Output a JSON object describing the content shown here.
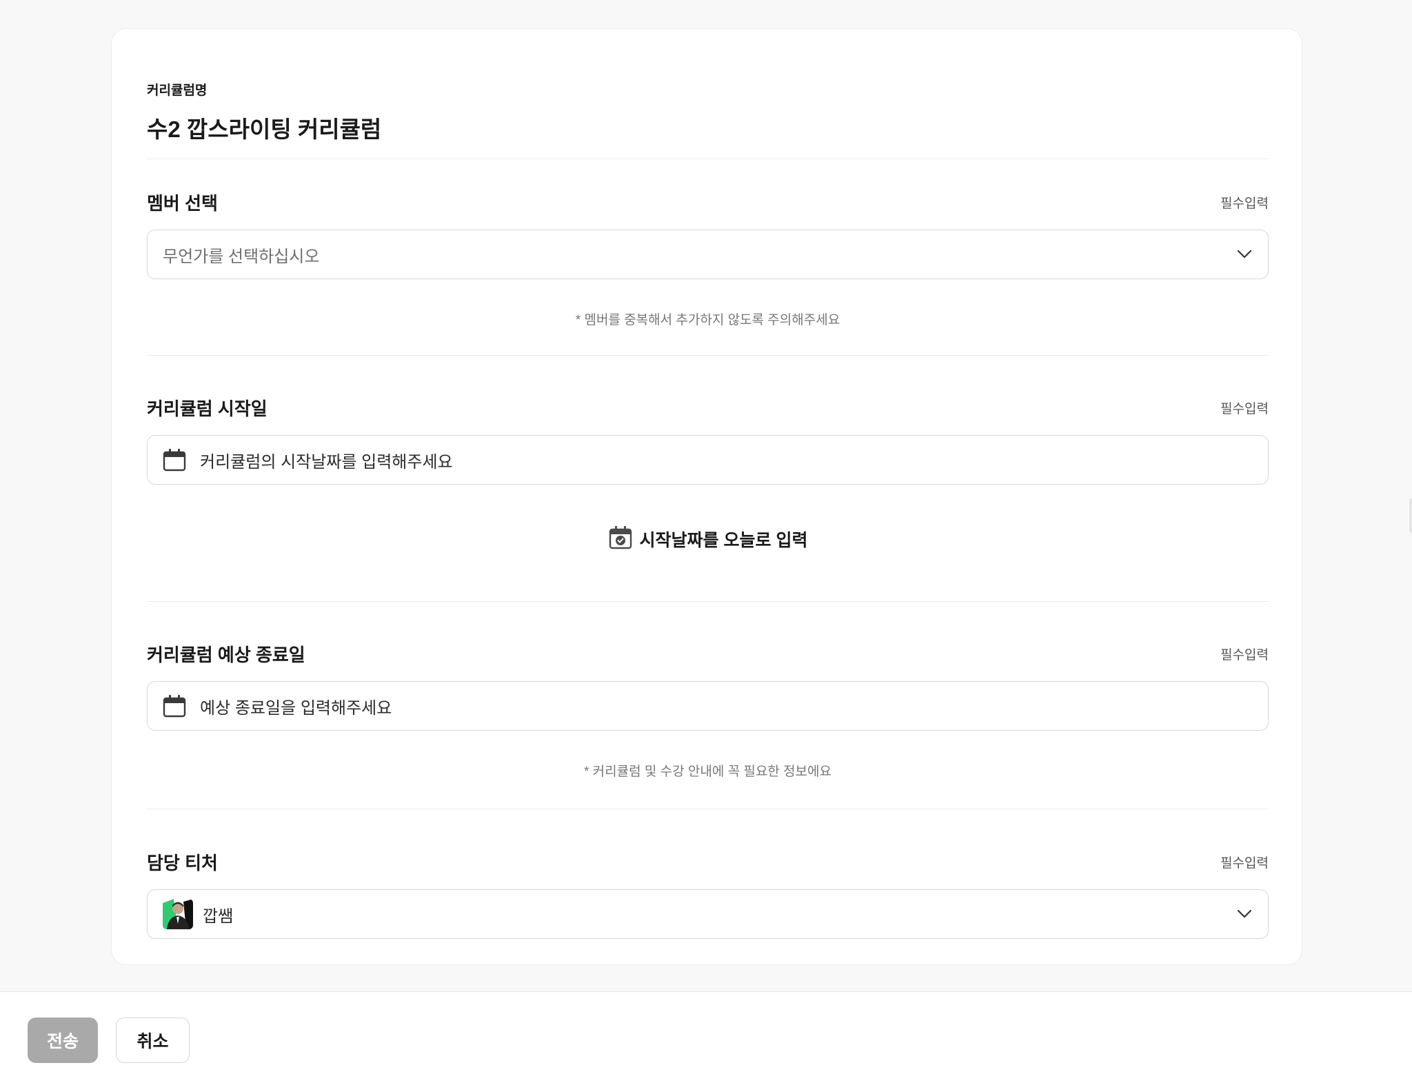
{
  "curriculum": {
    "label": "커리큘럼명",
    "name": "수2 깝스라이팅 커리큘럼"
  },
  "member_select": {
    "title": "멤버 선택",
    "required": "필수입력",
    "placeholder": "무언가를 선택하십시오",
    "hint": "* 멤버를 중복해서 추가하지 않도록 주의해주세요"
  },
  "start_date": {
    "title": "커리큘럼 시작일",
    "required": "필수입력",
    "placeholder": "커리큘럼의 시작날짜를 입력해주세요",
    "today_button": "시작날짜를 오늘로 입력"
  },
  "end_date": {
    "title": "커리큘럼 예상 종료일",
    "required": "필수입력",
    "placeholder": "예상 종료일을 입력해주세요",
    "hint": "* 커리큘럼 및 수강 안내에 꼭 필요한 정보에요"
  },
  "teacher": {
    "title": "담당 티처",
    "required": "필수입력",
    "selected": "깝쌤"
  },
  "footer": {
    "submit_label": "전송",
    "cancel_label": "취소"
  },
  "colors": {
    "page_bg": "#f8f8f8",
    "card_bg": "#ffffff",
    "border": "#d8d8d8",
    "submit_disabled": "#a9a9a9",
    "avatar_accent": "#2ecc71"
  }
}
